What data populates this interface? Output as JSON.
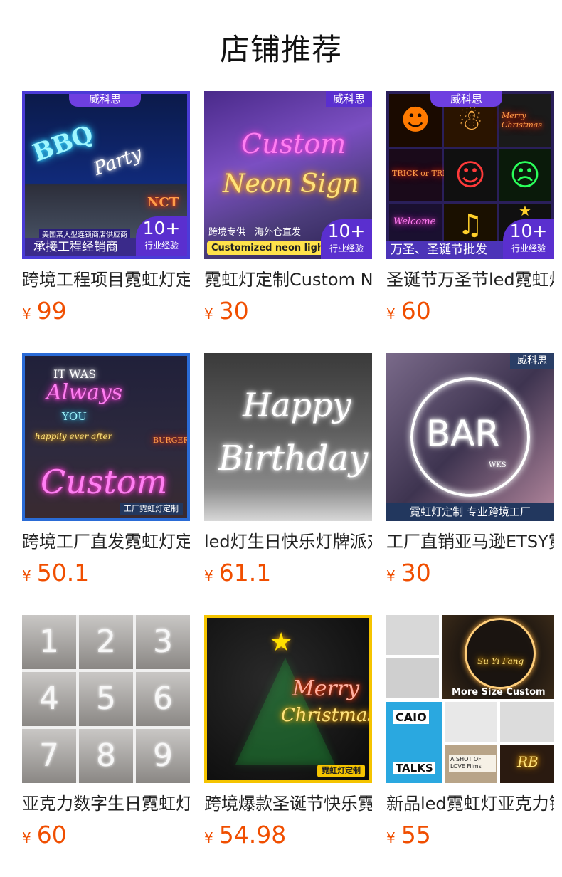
{
  "header": {
    "title": "店铺推荐"
  },
  "currency": "¥",
  "products": [
    {
      "name": "跨境工程项目霓虹灯定制",
      "price": "99",
      "image": {
        "brand": "威科思",
        "sign_lines": [
          "BBQ",
          "Party"
        ],
        "caption_small": "美国某大型连锁商店供应商",
        "caption": "承接工程经销商",
        "badge_big": "10+",
        "badge_small": "行业经验",
        "sub_sign": "NCT"
      }
    },
    {
      "name": "霓虹灯定制Custom Neon Sign",
      "price": "30",
      "image": {
        "brand": "威科思",
        "sign_lines": [
          "Custom",
          "Neon Sign"
        ],
        "tag_line": "跨境专供　海外仓直发",
        "caption": "Customized neon lights",
        "badge_big": "10+",
        "badge_small": "行业经验"
      }
    },
    {
      "name": "圣诞节万圣节led霓虹灯",
      "price": "60",
      "image": {
        "brand": "威科思",
        "tiles": [
          "Merry Christmas",
          "TRICK or TREAT",
          "Welcome"
        ],
        "caption": "万圣、圣诞节批发",
        "badge_big": "10+",
        "badge_small": "行业经验"
      }
    },
    {
      "name": "跨境工厂直发霓虹灯定制",
      "price": "50.1",
      "image": {
        "sign_lines": [
          "IT WAS",
          "Always",
          "YOU",
          "happily ever after",
          "BURGER",
          "Custom"
        ],
        "factory_tag": "工厂霓虹灯定制"
      }
    },
    {
      "name": "led灯生日快乐灯牌派对",
      "price": "61.1",
      "image": {
        "sign_lines": [
          "Happy",
          "Birthday"
        ]
      }
    },
    {
      "name": "工厂直销亚马逊ETSY霓虹灯",
      "price": "30",
      "image": {
        "brand": "威科思",
        "sign_lines": [
          "BAR",
          "WKS"
        ],
        "caption": "霓虹灯定制 专业跨境工厂"
      }
    },
    {
      "name": "亚克力数字生日霓虹灯",
      "price": "60",
      "image": {
        "digits": [
          "1",
          "2",
          "3",
          "4",
          "5",
          "6",
          "7",
          "8",
          "9"
        ]
      }
    },
    {
      "name": "跨境爆款圣诞节快乐霓虹灯",
      "price": "54.98",
      "image": {
        "sign_lines": [
          "Merry",
          "Christmas"
        ],
        "factory_tag": "霓虹灯定制"
      }
    },
    {
      "name": "新品led霓虹灯亚克力镜面",
      "price": "55",
      "image": {
        "sign_lines": [
          "Su Yi Fang",
          "More Size Custom",
          "CAIO",
          "TALKS",
          "A SHOT OF LOVE Films",
          "RB"
        ]
      }
    }
  ]
}
